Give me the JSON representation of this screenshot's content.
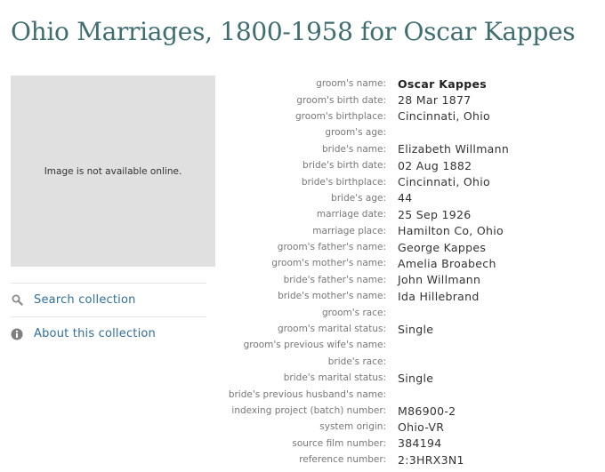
{
  "title": "Ohio Marriages, 1800-1958 for Oscar Kappes",
  "image_placeholder": "Image is not available online.",
  "sidebar": {
    "links": [
      {
        "label": "Search collection",
        "icon": "search-icon"
      },
      {
        "label": "About this collection",
        "icon": "info-icon"
      }
    ]
  },
  "record": {
    "fields": [
      {
        "label": "groom's name:",
        "value": "Oscar Kappes"
      },
      {
        "label": "groom's birth date:",
        "value": "28 Mar 1877"
      },
      {
        "label": "groom's birthplace:",
        "value": "Cincinnati, Ohio"
      },
      {
        "label": "groom's age:",
        "value": ""
      },
      {
        "label": "bride's name:",
        "value": "Elizabeth Willmann"
      },
      {
        "label": "bride's birth date:",
        "value": "02 Aug 1882"
      },
      {
        "label": "bride's birthplace:",
        "value": "Cincinnati, Ohio"
      },
      {
        "label": "bride's age:",
        "value": "44"
      },
      {
        "label": "marriage date:",
        "value": "25 Sep 1926"
      },
      {
        "label": "marriage place:",
        "value": "Hamilton Co, Ohio"
      },
      {
        "label": "groom's father's name:",
        "value": "George Kappes"
      },
      {
        "label": "groom's mother's name:",
        "value": "Amelia Broabech"
      },
      {
        "label": "bride's father's name:",
        "value": "John Willmann"
      },
      {
        "label": "bride's mother's name:",
        "value": "Ida Hillebrand"
      },
      {
        "label": "groom's race:",
        "value": ""
      },
      {
        "label": "groom's marital status:",
        "value": "Single"
      },
      {
        "label": "groom's previous wife's name:",
        "value": ""
      },
      {
        "label": "bride's race:",
        "value": ""
      },
      {
        "label": "bride's marital status:",
        "value": "Single"
      },
      {
        "label": "bride's previous husband's name:",
        "value": ""
      },
      {
        "label": "indexing project (batch) number:",
        "value": "M86900-2"
      },
      {
        "label": "system origin:",
        "value": "Ohio-VR"
      },
      {
        "label": "source film number:",
        "value": "384194"
      },
      {
        "label": "reference number:",
        "value": "2:3HRX3N1"
      }
    ]
  },
  "colors": {
    "title": "#3f6e70",
    "link": "#316f9b",
    "placeholder_bg": "#e0e0e0",
    "label": "#777777",
    "value": "#333333"
  }
}
